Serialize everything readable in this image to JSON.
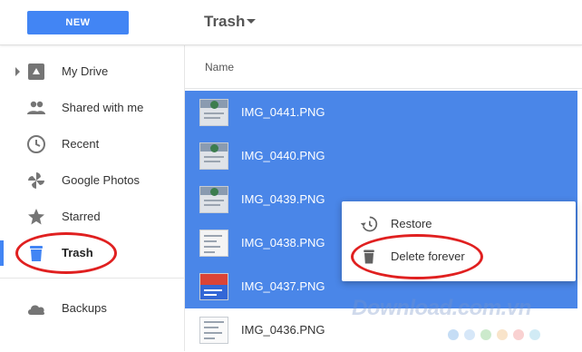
{
  "header": {
    "new_label": "NEW",
    "title": "Trash"
  },
  "sidebar": {
    "items": [
      {
        "label": "My Drive",
        "icon": "drive-icon"
      },
      {
        "label": "Shared with me",
        "icon": "people-icon"
      },
      {
        "label": "Recent",
        "icon": "clock-icon"
      },
      {
        "label": "Google Photos",
        "icon": "photos-pinwheel-icon"
      },
      {
        "label": "Starred",
        "icon": "star-icon"
      },
      {
        "label": "Trash",
        "icon": "trash-icon",
        "active": true
      },
      {
        "label": "Backups",
        "icon": "cloud-icon"
      }
    ]
  },
  "main": {
    "column_header": "Name",
    "files": [
      {
        "name": "IMG_0441.PNG",
        "selected": true
      },
      {
        "name": "IMG_0440.PNG",
        "selected": true
      },
      {
        "name": "IMG_0439.PNG",
        "selected": true
      },
      {
        "name": "IMG_0438.PNG",
        "selected": true
      },
      {
        "name": "IMG_0437.PNG",
        "selected": true
      },
      {
        "name": "IMG_0436.PNG",
        "selected": false
      }
    ]
  },
  "context_menu": {
    "restore_label": "Restore",
    "delete_label": "Delete forever"
  },
  "watermark": {
    "text": "Download.com.vn",
    "dot_colors": [
      "#7fb3e8",
      "#a3c9f0",
      "#8fd18f",
      "#f2c48a",
      "#f29a9a",
      "#9ad3e8"
    ]
  },
  "colors": {
    "accent": "#4285f4",
    "selection": "#4a86e8",
    "highlight_circle": "#e02020"
  }
}
